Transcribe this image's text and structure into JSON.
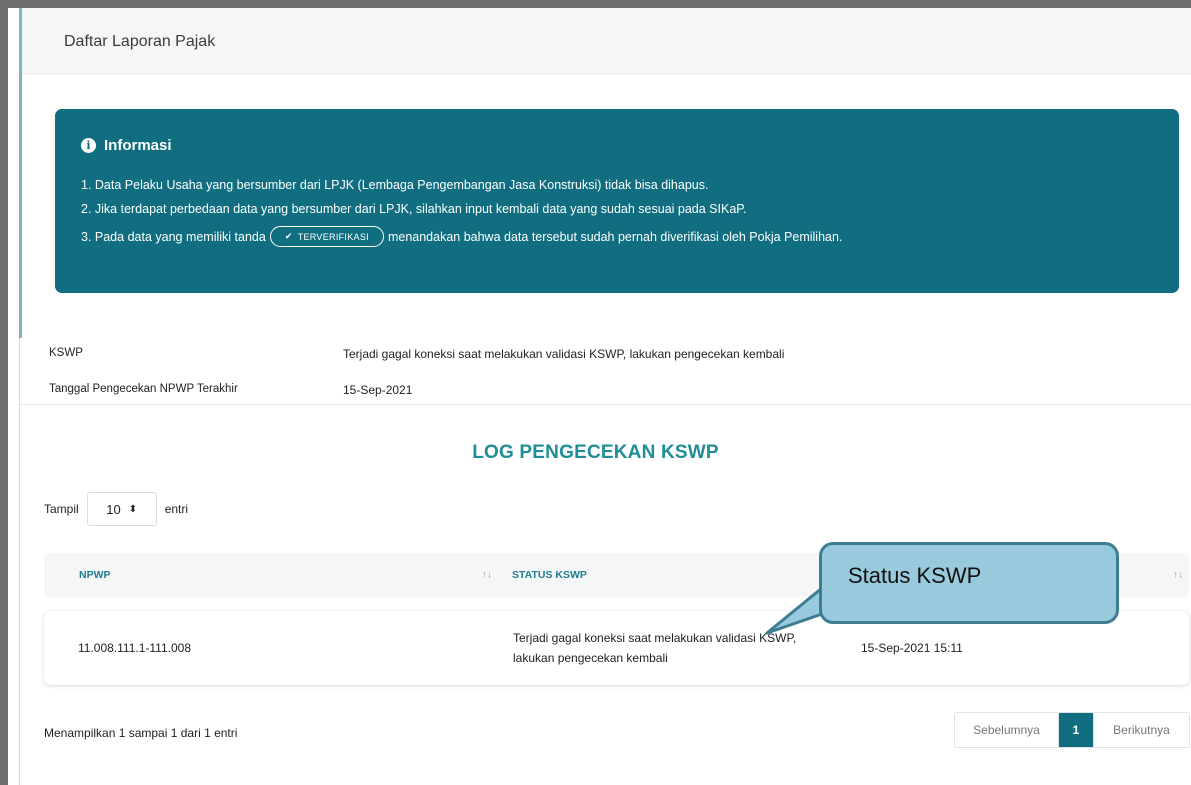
{
  "header": {
    "title": "Daftar Laporan Pajak"
  },
  "info": {
    "heading": "Informasi",
    "icon": "info-circle-icon",
    "line1": "1. Data Pelaku Usaha yang bersumber dari LPJK (Lembaga Pengembangan Jasa Konstruksi) tidak bisa dihapus.",
    "line2": "2. Jika terdapat perbedaan data yang bersumber dari LPJK, silahkan input kembali data yang sudah sesuai pada SIKaP.",
    "line3_before": "3. Pada data yang memiliki tanda",
    "badge": "TERVERIFIKASI",
    "line3_after": "menandakan bahwa data tersebut sudah pernah diverifikasi oleh Pokja Pemilihan.",
    "bg_color": "#106e80"
  },
  "kswp": {
    "label": "KSWP",
    "value": "Terjadi gagal koneksi saat melakukan validasi KSWP, lakukan pengecekan kembali",
    "date_label": "Tanggal Pengecekan NPWP Terakhir",
    "date_value": "15-Sep-2021"
  },
  "log": {
    "title": "LOG PENGECEKAN KSWP",
    "show_label": "Tampil",
    "show_value": "10",
    "entries_label": "entri",
    "columns": [
      "NPWP",
      "STATUS KSWP"
    ],
    "rows": [
      {
        "npwp": "11.008.111.1-111.008",
        "status_line1": "Terjadi gagal koneksi saat melakukan validasi KSWP,",
        "status_line2": "lakukan pengecekan kembali",
        "date": "15-Sep-2021 15:11"
      }
    ],
    "info": "Menampilkan 1 sampai 1 dari 1 entri",
    "pager": {
      "prev": "Sebelumnya",
      "current": "1",
      "next": "Berikutnya"
    }
  },
  "callout": {
    "text": "Status KSWP",
    "color": "#98c9dc"
  }
}
